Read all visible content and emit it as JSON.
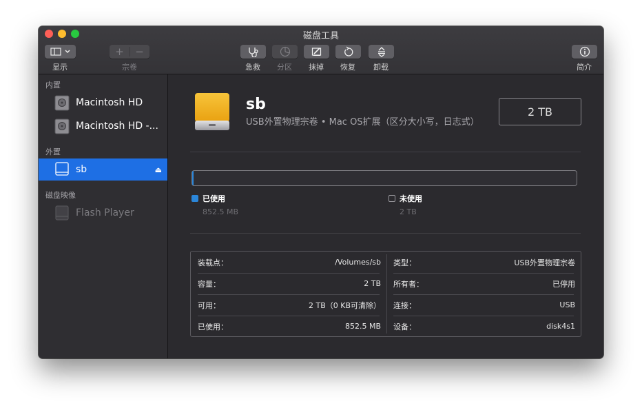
{
  "window": {
    "title": "磁盘工具"
  },
  "toolbar": {
    "view_label": "显示",
    "volume_label": "宗卷",
    "first_aid_label": "急救",
    "partition_label": "分区",
    "erase_label": "抹掉",
    "restore_label": "恢复",
    "unmount_label": "卸载",
    "info_label": "简介"
  },
  "sidebar": {
    "section_internal": "内置",
    "section_external": "外置",
    "section_images": "磁盘映像",
    "internal_items": [
      {
        "label": "Macintosh HD"
      },
      {
        "label": "Macintosh HD -..."
      }
    ],
    "external_items": [
      {
        "label": "sb"
      }
    ],
    "image_items": [
      {
        "label": "Flash Player"
      }
    ]
  },
  "disk": {
    "name": "sb",
    "description": "USB外置物理宗卷 • Mac OS扩展（区分大小写，日志式）",
    "size": "2 TB",
    "used_fraction": 0.0004
  },
  "usage": {
    "used_label": "已使用",
    "used_value": "852.5 MB",
    "free_label": "未使用",
    "free_value": "2 TB"
  },
  "info": {
    "left": [
      {
        "key": "装载点：",
        "value": "/Volumes/sb"
      },
      {
        "key": "容量：",
        "value": "2 TB"
      },
      {
        "key": "可用：",
        "value": "2 TB（0 KB可清除）"
      },
      {
        "key": "已使用：",
        "value": "852.5 MB"
      }
    ],
    "right": [
      {
        "key": "类型：",
        "value": "USB外置物理宗卷"
      },
      {
        "key": "所有者：",
        "value": "已停用"
      },
      {
        "key": "连接：",
        "value": "USB"
      },
      {
        "key": "设备：",
        "value": "disk4s1"
      }
    ]
  },
  "colors": {
    "accent": "#1e6fe4",
    "used": "#2b86d9",
    "drive_orange": "#f2b51c"
  }
}
